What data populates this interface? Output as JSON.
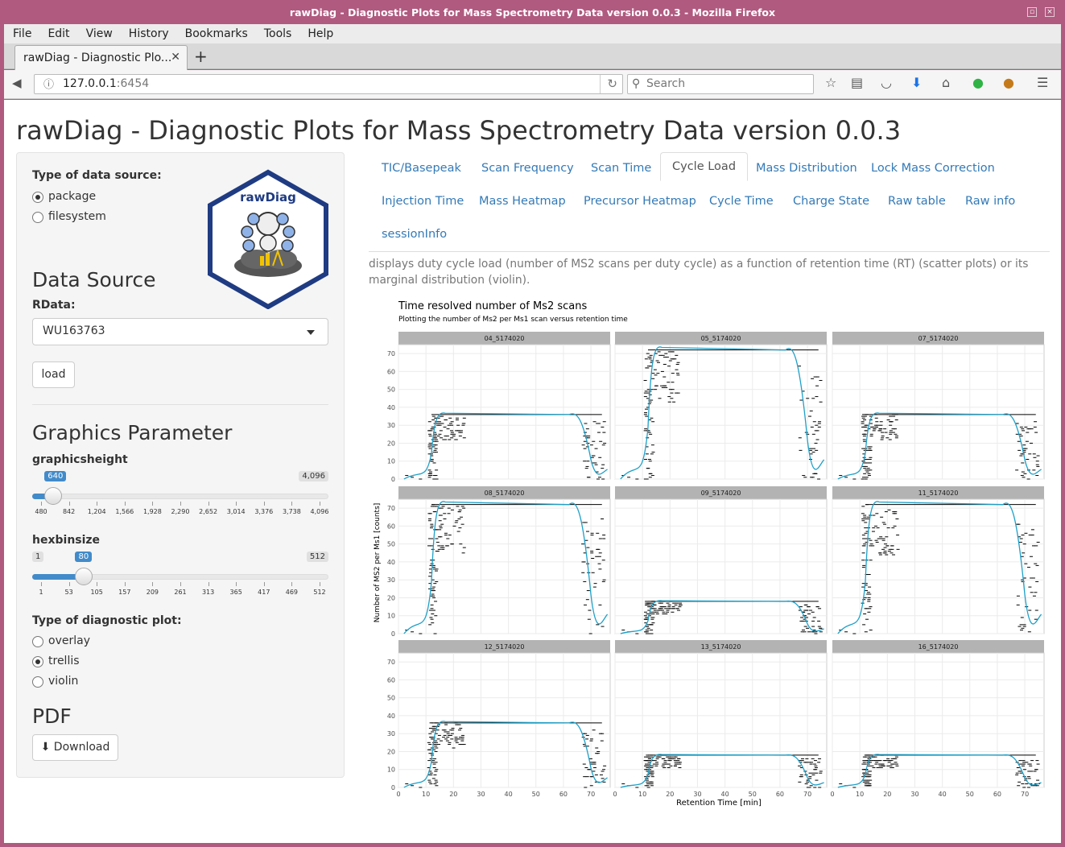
{
  "window": {
    "title": "rawDiag - Diagnostic Plots for Mass Spectrometry Data version 0.0.3 - Mozilla Firefox"
  },
  "menu": [
    "File",
    "Edit",
    "View",
    "History",
    "Bookmarks",
    "Tools",
    "Help"
  ],
  "tab": {
    "label": "rawDiag - Diagnostic Plo..."
  },
  "nav": {
    "url_host": "127.0.0.1",
    "url_port": ":6454",
    "search_placeholder": "Search"
  },
  "page": {
    "title": "rawDiag - Diagnostic Plots for Mass Spectrometry Data version 0.0.3"
  },
  "sidebar": {
    "source_label": "Type of data source:",
    "source_options": [
      {
        "label": "package",
        "checked": true
      },
      {
        "label": "filesystem",
        "checked": false
      }
    ],
    "logo_text": "rawDiag",
    "data_source_heading": "Data Source",
    "rdata_label": "RData:",
    "rdata_value": "WU163763",
    "load_label": "load",
    "graphics_heading": "Graphics Parameter",
    "gh_label": "graphicsheight",
    "gh": {
      "min": "480",
      "max": "4,096",
      "value": "640",
      "value_num": 640,
      "min_num": 480,
      "max_num": 4096,
      "ticks": [
        "480",
        "842",
        "1,204",
        "1,566",
        "1,928",
        "2,290",
        "2,652",
        "3,014",
        "3,376",
        "3,738",
        "4,096"
      ]
    },
    "hb_label": "hexbinsize",
    "hb": {
      "min": "1",
      "max": "512",
      "value": "80",
      "value_num": 80,
      "min_num": 1,
      "max_num": 512,
      "ticks": [
        "1",
        "53",
        "105",
        "157",
        "209",
        "261",
        "313",
        "365",
        "417",
        "469",
        "512"
      ]
    },
    "plot_type_label": "Type of diagnostic plot:",
    "plot_types": [
      {
        "label": "overlay",
        "checked": false
      },
      {
        "label": "trellis",
        "checked": true
      },
      {
        "label": "violin",
        "checked": false
      }
    ],
    "pdf_heading": "PDF",
    "download_label": "Download"
  },
  "tabs": [
    "TIC/Basepeak",
    "Scan Frequency",
    "Scan Time",
    "Cycle Load",
    "Mass Distribution",
    "Lock Mass Correction",
    "Injection Time",
    "Mass Heatmap",
    "Precursor Heatmap",
    "Cycle Time",
    "Charge State",
    "Raw table",
    "Raw info",
    "sessionInfo"
  ],
  "active_tab": "Cycle Load",
  "description": "displays duty cycle load (number of MS2 scans per duty cycle) as a function of retention time (RT) (scatter plots) or its marginal distribution (violin).",
  "chart_data": {
    "type": "scatter",
    "title": "Time resolved number of Ms2 scans",
    "subtitle": "Plotting the number of Ms2 per Ms1 scan versus retention time",
    "xlabel": "Retention Time [min]",
    "ylabel": "Number of MS2 per Ms1 [counts]",
    "xlim": [
      0,
      77
    ],
    "ylim": [
      0,
      75
    ],
    "x_ticks": [
      0,
      10,
      20,
      30,
      40,
      50,
      60,
      70
    ],
    "y_ticks": [
      0,
      10,
      20,
      30,
      40,
      50,
      60,
      70
    ],
    "grid": true,
    "line_color": "#1fa0c8",
    "panels": [
      {
        "name": "04_5174020",
        "max": 36,
        "plateau": [
          15,
          68
        ]
      },
      {
        "name": "05_5174020",
        "max": 72,
        "plateau": [
          15,
          68
        ]
      },
      {
        "name": "07_5174020",
        "max": 36,
        "plateau": [
          15,
          68
        ]
      },
      {
        "name": "08_5174020",
        "max": 72,
        "plateau": [
          15,
          68
        ]
      },
      {
        "name": "09_5174020",
        "max": 18,
        "plateau": [
          15,
          68
        ]
      },
      {
        "name": "11_5174020",
        "max": 72,
        "plateau": [
          15,
          68
        ]
      },
      {
        "name": "12_5174020",
        "max": 36,
        "plateau": [
          15,
          68
        ]
      },
      {
        "name": "13_5174020",
        "max": 18,
        "plateau": [
          15,
          68
        ]
      },
      {
        "name": "16_5174020",
        "max": 18,
        "plateau": [
          15,
          68
        ]
      }
    ]
  }
}
